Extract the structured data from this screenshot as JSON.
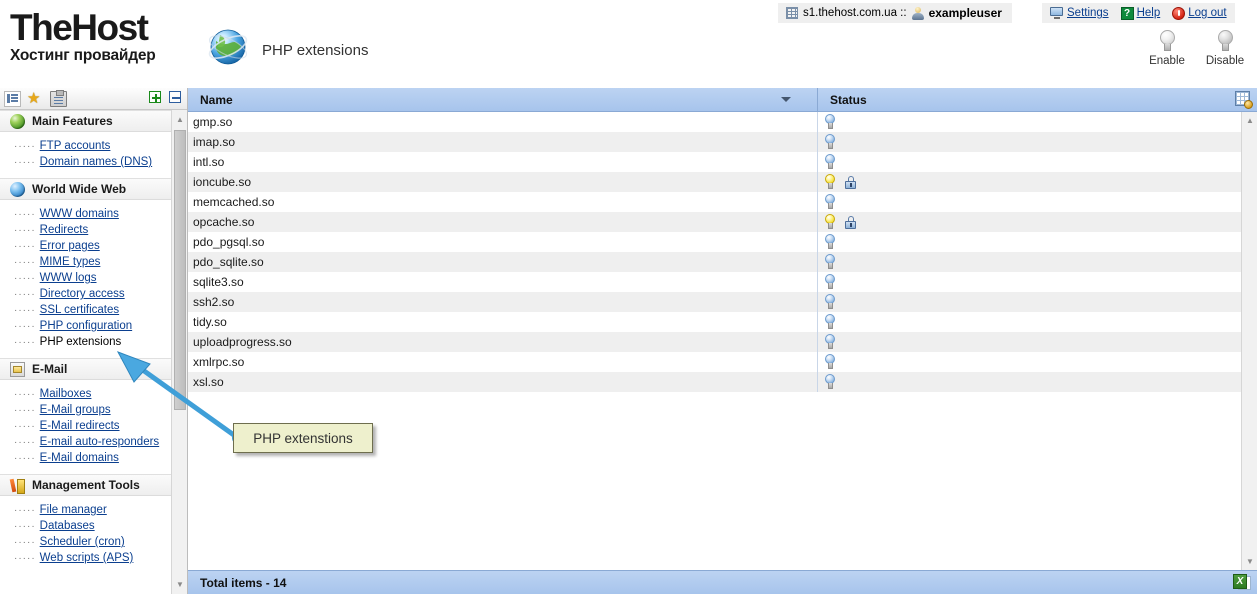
{
  "branding": {
    "logo_main": "TheHost",
    "logo_sub": "Хостинг провайдер",
    "page_title": "PHP extensions",
    "globe_icon": "globe-icon"
  },
  "account_bar": {
    "server_icon": "server-icon",
    "server": "s1.thehost.com.ua ::",
    "user_icon": "user-icon",
    "username": "exampleuser",
    "links": [
      {
        "icon": "monitor-settings-icon",
        "label": "Settings"
      },
      {
        "icon": "help-icon",
        "label": "Help"
      },
      {
        "icon": "power-icon",
        "label": "Log out"
      }
    ]
  },
  "toolbar_buttons": [
    {
      "icon": "lightbulb-icon",
      "label": "Enable"
    },
    {
      "icon": "lightbulb-icon",
      "label": "Disable"
    }
  ],
  "sidebar": {
    "toolbar": {
      "icons": [
        {
          "name": "list-view-icon",
          "selected": true
        },
        {
          "name": "star-favorites-icon",
          "selected": false
        },
        {
          "name": "clipboard-icon",
          "selected": false
        }
      ],
      "expand_all": "expand-all-button",
      "collapse_all": "collapse-all-button"
    },
    "sections": [
      {
        "title": "Main Features",
        "icon": "globe-green-icon",
        "items": [
          {
            "label": "FTP accounts",
            "active": false
          },
          {
            "label": "Domain names (DNS)",
            "active": false
          }
        ]
      },
      {
        "title": "World Wide Web",
        "icon": "globe-blue-icon",
        "items": [
          {
            "label": "WWW domains",
            "active": false
          },
          {
            "label": "Redirects",
            "active": false
          },
          {
            "label": "Error pages",
            "active": false
          },
          {
            "label": "MIME types",
            "active": false
          },
          {
            "label": "WWW logs",
            "active": false
          },
          {
            "label": "Directory access",
            "active": false
          },
          {
            "label": "SSL certificates",
            "active": false
          },
          {
            "label": "PHP configuration",
            "active": false
          },
          {
            "label": "PHP extensions",
            "active": true
          }
        ]
      },
      {
        "title": "E-Mail",
        "icon": "envelope-icon",
        "items": [
          {
            "label": "Mailboxes",
            "active": false
          },
          {
            "label": "E-Mail groups",
            "active": false
          },
          {
            "label": "E-Mail redirects",
            "active": false
          },
          {
            "label": "E-mail auto-responders",
            "active": false
          },
          {
            "label": "E-Mail domains",
            "active": false
          }
        ]
      },
      {
        "title": "Management Tools",
        "icon": "tools-icon",
        "items": [
          {
            "label": "File manager",
            "active": false
          },
          {
            "label": "Databases",
            "active": false
          },
          {
            "label": "Scheduler (cron)",
            "active": false
          },
          {
            "label": "Web scripts (APS)",
            "active": false
          }
        ]
      }
    ]
  },
  "grid": {
    "columns": [
      {
        "label": "Name",
        "sort_icon": "sort-descending-icon"
      },
      {
        "label": "Status"
      }
    ],
    "settings_icon": "grid-settings-icon",
    "rows": [
      {
        "name": "gmp.so",
        "enabled": false,
        "locked": false
      },
      {
        "name": "imap.so",
        "enabled": false,
        "locked": false
      },
      {
        "name": "intl.so",
        "enabled": false,
        "locked": false
      },
      {
        "name": "ioncube.so",
        "enabled": true,
        "locked": true
      },
      {
        "name": "memcached.so",
        "enabled": false,
        "locked": false
      },
      {
        "name": "opcache.so",
        "enabled": true,
        "locked": true
      },
      {
        "name": "pdo_pgsql.so",
        "enabled": false,
        "locked": false
      },
      {
        "name": "pdo_sqlite.so",
        "enabled": false,
        "locked": false
      },
      {
        "name": "sqlite3.so",
        "enabled": false,
        "locked": false
      },
      {
        "name": "ssh2.so",
        "enabled": false,
        "locked": false
      },
      {
        "name": "tidy.so",
        "enabled": false,
        "locked": false
      },
      {
        "name": "uploadprogress.so",
        "enabled": false,
        "locked": false
      },
      {
        "name": "xmlrpc.so",
        "enabled": false,
        "locked": false
      },
      {
        "name": "xsl.so",
        "enabled": false,
        "locked": false
      }
    ],
    "status_bar": {
      "total_label": "Total items - 14",
      "export_icon": "excel-export-icon"
    }
  },
  "annotation": {
    "callout_text": "PHP extenstions",
    "arrow_color": "#3f9fd8",
    "callout_bg": "#eef0cd"
  }
}
